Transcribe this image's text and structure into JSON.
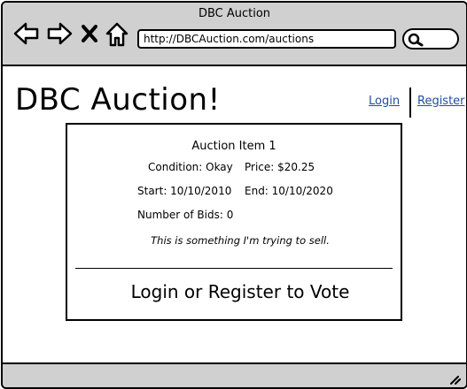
{
  "window": {
    "title": "DBC Auction",
    "url": "http://DBCAuction.com/auctions"
  },
  "nav_icons": [
    "back-arrow-icon",
    "forward-arrow-icon",
    "stop-icon",
    "home-icon",
    "search-icon"
  ],
  "header": {
    "site_title": "DBC Auction!",
    "login_label": "Login",
    "register_label": "Register"
  },
  "item": {
    "title": "Auction Item 1",
    "condition": "Condition: Okay",
    "price": "Price: $20.25",
    "start": "Start: 10/10/2010",
    "end": "End: 10/10/2020",
    "bids": "Number of Bids: 0",
    "description": "This is something I'm trying to sell.",
    "vote_prompt": "Login or Register to Vote"
  },
  "colors": {
    "chrome_gray": "#d0d0d0",
    "link_blue": "#1f4fa0",
    "border": "#000000"
  }
}
